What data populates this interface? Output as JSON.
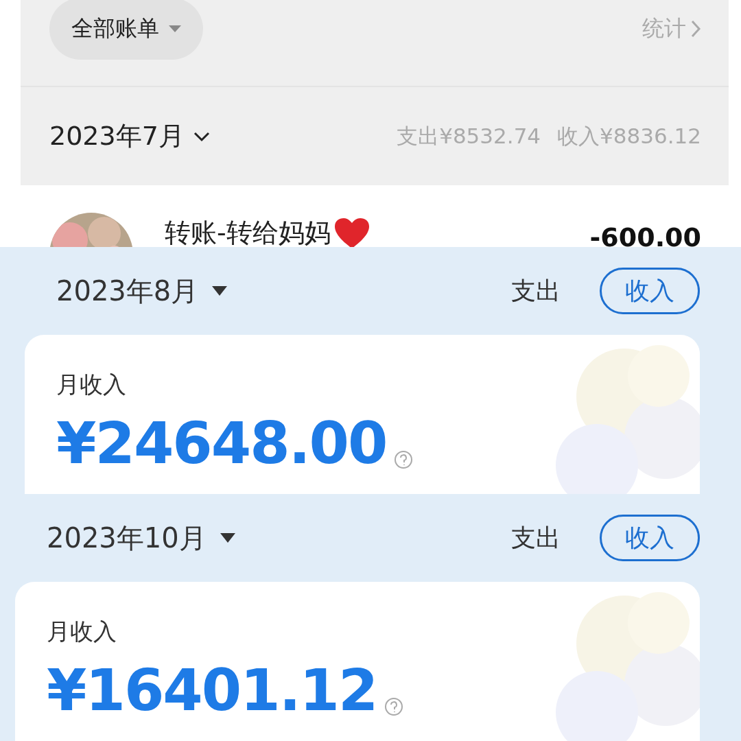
{
  "bills": {
    "filter": "全部账单",
    "stats_link": "统计",
    "month": "2023年7月",
    "expense": "支出¥8532.74",
    "income": "收入¥8836.12",
    "transactions": [
      {
        "title": "转账-转给妈妈",
        "amount": "-600.00",
        "heart": true
      }
    ]
  },
  "panels": [
    {
      "month": "2023年8月",
      "tabs": [
        {
          "label": "支出",
          "selected": false
        },
        {
          "label": "收入",
          "selected": true
        }
      ],
      "label": "月收入",
      "amount": "¥24648.00"
    },
    {
      "month": "2023年10月",
      "tabs": [
        {
          "label": "支出",
          "selected": false
        },
        {
          "label": "收入",
          "selected": true
        }
      ],
      "label": "月收入",
      "amount": "¥16401.12"
    }
  ]
}
